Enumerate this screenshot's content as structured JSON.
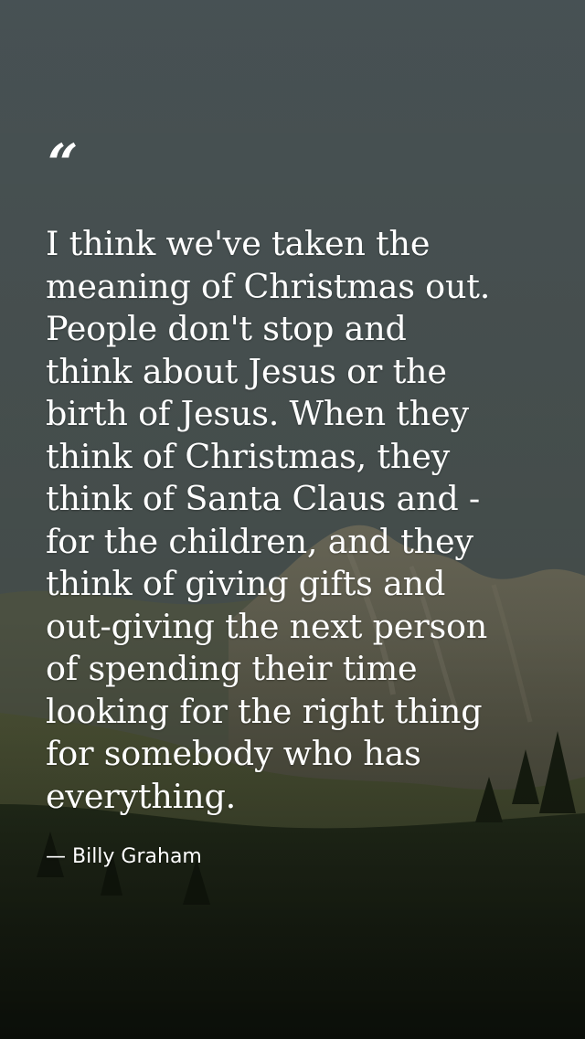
{
  "quote": {
    "mark": "“",
    "text": "I think we've taken the\nmeaning of Christmas out.\nPeople don't stop and\nthink about Jesus or the\nbirth of Jesus. When they\nthink of Christmas, they\nthink of Santa Claus and -\nfor the children, and they\nthink of giving gifts and\nout-giving the next person\nof spending their time\nlooking for the right thing\nfor somebody who has\neverything.",
    "author": "— Billy Graham"
  },
  "colors": {
    "sky": "#4e5a5c",
    "mountain": "#6e6a5a",
    "forest": "#1e2818",
    "text": "#ffffff"
  }
}
